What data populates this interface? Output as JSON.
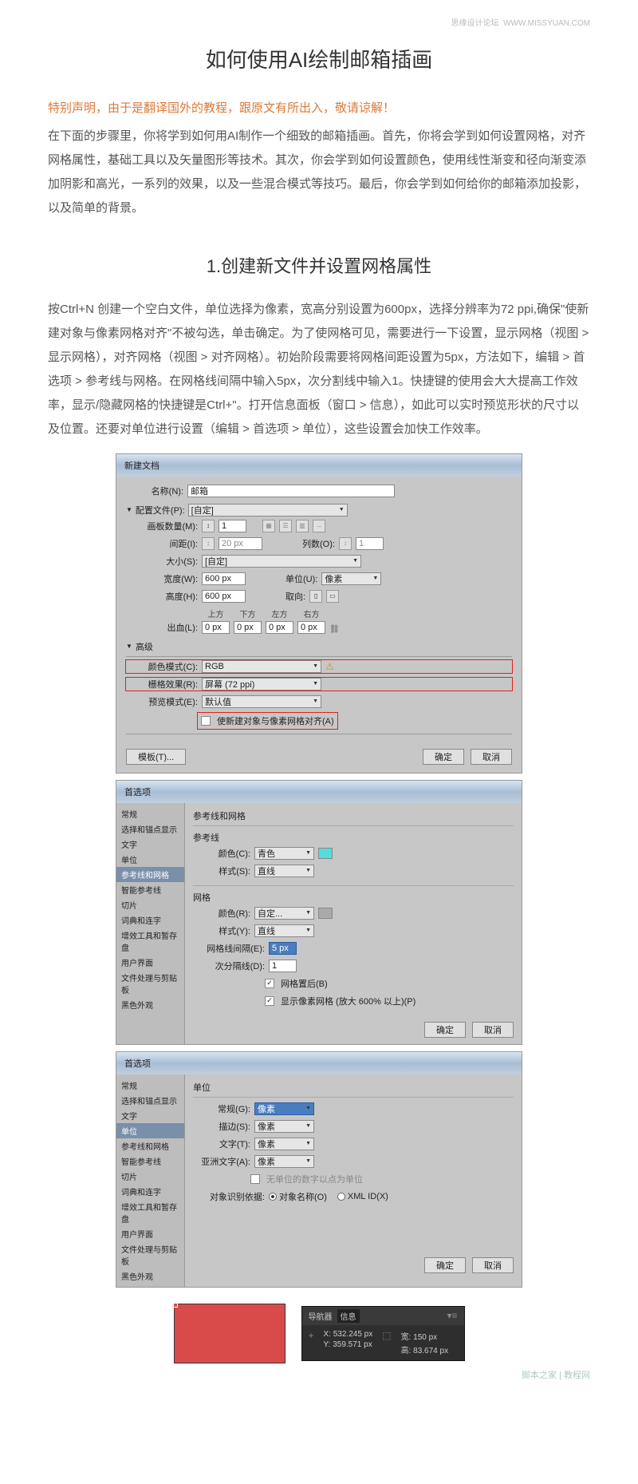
{
  "watermark_top_left": "思缘设计论坛",
  "watermark_top_right": "WWW.MISSYUAN.COM",
  "title": "如何使用AI绘制邮箱插画",
  "disclaimer": "特别声明，由于是翻译国外的教程，跟原文有所出入，敬请谅解！",
  "intro": "在下面的步骤里，你将学到如何用AI制作一个细致的邮箱插画。首先，你将会学到如何设置网格，对齐网格属性，基础工具以及矢量图形等技术。其次，你会学到如何设置颜色，使用线性渐变和径向渐变添加阴影和高光，一系列的效果，以及一些混合模式等技巧。最后，你会学到如何给你的邮箱添加投影，以及简单的背景。",
  "section1_title": "1.创建新文件并设置网格属性",
  "section1_text": "按Ctrl+N 创建一个空白文件，单位选择为像素，宽高分别设置为600px，选择分辨率为72 ppi,确保\"使新建对象与像素网格对齐\"不被勾选，单击确定。为了使网格可见，需要进行一下设置，显示网格（视图 > 显示网格），对齐网格（视图 > 对齐网格）。初始阶段需要将网格间距设置为5px，方法如下，编辑 > 首选项 > 参考线与网格。在网格线间隔中输入5px，次分割线中输入1。快捷键的使用会大大提高工作效率，显示/隐藏网格的快捷键是Ctrl+\"。打开信息面板（窗口 > 信息），如此可以实时预览形状的尺寸以及位置。还要对单位进行设置（编辑 > 首选项 > 单位），这些设置会加快工作效率。",
  "dialog1": {
    "title": "新建文档",
    "name_label": "名称(N):",
    "name_value": "邮箱",
    "profile_label": "配置文件(P):",
    "profile_value": "[自定]",
    "artboards_label": "画板数量(M):",
    "artboards_value": "1",
    "spacing_label": "间距(I):",
    "spacing_value": "20 px",
    "cols_label": "列数(O):",
    "cols_value": "1",
    "size_label": "大小(S):",
    "size_value": "[自定]",
    "width_label": "宽度(W):",
    "width_value": "600 px",
    "units_label": "单位(U):",
    "units_value": "像素",
    "height_label": "高度(H):",
    "height_value": "600 px",
    "orient_label": "取向:",
    "bleed_label": "出血(L):",
    "bleed_top": "上方",
    "bleed_bottom": "下方",
    "bleed_left": "左方",
    "bleed_right": "右方",
    "bleed_value": "0 px",
    "advanced_label": "高级",
    "colormode_label": "颜色模式(C):",
    "colormode_value": "RGB",
    "raster_label": "栅格效果(R):",
    "raster_value": "屏幕 (72 ppi)",
    "preview_label": "预览模式(E):",
    "preview_value": "默认值",
    "align_checkbox": "使新建对象与像素网格对齐(A)",
    "templates_btn": "模板(T)...",
    "ok_btn": "确定",
    "cancel_btn": "取消"
  },
  "dialog2": {
    "title": "首选项",
    "sidebar": [
      "常规",
      "选择和锚点显示",
      "文字",
      "单位",
      "参考线和网格",
      "智能参考线",
      "切片",
      "词典和连字",
      "增效工具和暂存盘",
      "用户界面",
      "文件处理与剪贴板",
      "黑色外观"
    ],
    "active_sidebar": "参考线和网格",
    "main_title": "参考线和网格",
    "guides_section": "参考线",
    "guide_color_label": "颜色(C):",
    "guide_color_value": "青色",
    "guide_style_label": "样式(S):",
    "guide_style_value": "直线",
    "grid_section": "网格",
    "grid_color_label": "颜色(R):",
    "grid_color_value": "自定...",
    "grid_style_label": "样式(Y):",
    "grid_style_value": "直线",
    "grid_every_label": "网格线间隔(E):",
    "grid_every_value": "5 px",
    "subdiv_label": "次分隔线(D):",
    "subdiv_value": "1",
    "grids_back": "网格置后(B)",
    "show_pixel": "显示像素网格 (放大 600% 以上)(P)",
    "ok_btn": "确定",
    "cancel_btn": "取消"
  },
  "dialog3": {
    "title": "首选项",
    "sidebar": [
      "常规",
      "选择和锚点显示",
      "文字",
      "单位",
      "参考线和网格",
      "智能参考线",
      "切片",
      "词典和连字",
      "增效工具和暂存盘",
      "用户界面",
      "文件处理与剪贴板",
      "黑色外观"
    ],
    "active_sidebar": "单位",
    "main_title": "单位",
    "general_label": "常规(G):",
    "general_value": "像素",
    "stroke_label": "描边(S):",
    "stroke_value": "像素",
    "type_label": "文字(T):",
    "type_value": "像素",
    "asian_label": "亚洲文字(A):",
    "asian_value": "像素",
    "no_unit_checkbox": "无单位的数字以点为单位",
    "identify_label": "对象识别依据:",
    "identify_name": "对象名称(O)",
    "identify_xml": "XML ID(X)",
    "ok_btn": "确定",
    "cancel_btn": "取消"
  },
  "info_panel": {
    "nav_tab": "导航器",
    "info_tab": "信息",
    "x_label": "X:",
    "x_value": "532.245 px",
    "y_label": "Y:",
    "y_value": "359.571 px",
    "w_label": "宽:",
    "w_value": "150 px",
    "h_label": "高:",
    "h_value": "83.674 px"
  },
  "watermark_btm": "脚本之家 | 教程网"
}
